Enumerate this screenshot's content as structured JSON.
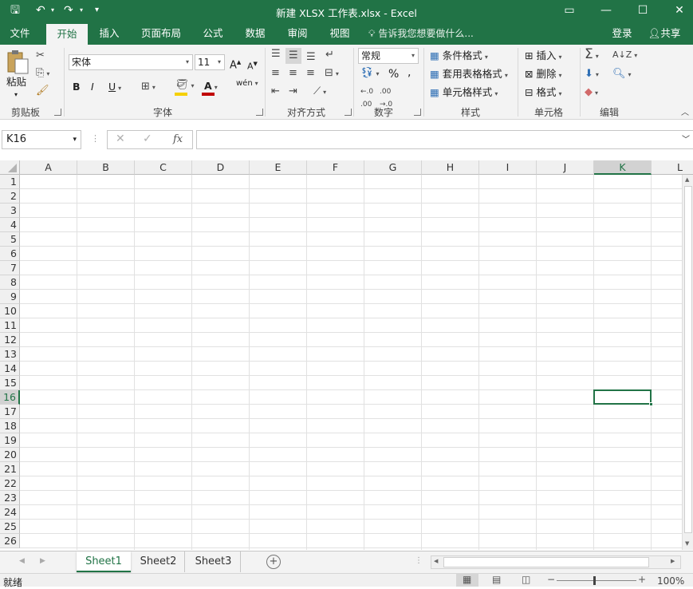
{
  "title": "新建 XLSX 工作表.xlsx - Excel",
  "quick_access": {
    "save": "🖫",
    "undo": "↶",
    "redo": "↷",
    "customize": "▾"
  },
  "window_controls": {
    "ribbon_options": "▭",
    "minimize": "—",
    "maximize": "☐",
    "close": "✕"
  },
  "tabs": [
    "文件",
    "开始",
    "插入",
    "页面布局",
    "公式",
    "数据",
    "审阅",
    "视图"
  ],
  "tell_me": "告诉我您想要做什么...",
  "login": "登录",
  "share": "共享",
  "ribbon": {
    "clipboard": {
      "label": "剪贴板",
      "paste": "粘贴"
    },
    "font": {
      "label": "字体",
      "name": "宋体",
      "size": "11",
      "bold": "B",
      "italic": "I",
      "underline": "U",
      "grow": "A",
      "shrink": "A",
      "font_color": "A",
      "phonetic": "wén"
    },
    "alignment": {
      "label": "对齐方式"
    },
    "number": {
      "label": "数字",
      "format": "常规",
      "percent": "%",
      "comma": ","
    },
    "styles": {
      "label": "样式",
      "conditional": "条件格式",
      "table": "套用表格格式",
      "cell_styles": "单元格样式"
    },
    "cells": {
      "label": "单元格",
      "insert": "插入",
      "delete": "删除",
      "format": "格式"
    },
    "editing": {
      "label": "编辑"
    }
  },
  "name_box": "K16",
  "formula_value": "",
  "columns": [
    "A",
    "B",
    "C",
    "D",
    "E",
    "F",
    "G",
    "H",
    "I",
    "J",
    "K",
    "L"
  ],
  "rows": [
    "1",
    "2",
    "3",
    "4",
    "5",
    "6",
    "7",
    "8",
    "9",
    "10",
    "11",
    "12",
    "13",
    "14",
    "15",
    "16",
    "17",
    "18",
    "19",
    "20",
    "21",
    "22",
    "23",
    "24",
    "25",
    "26"
  ],
  "active_cell": {
    "column": "K",
    "row": "16"
  },
  "sheets": [
    "Sheet1",
    "Sheet2",
    "Sheet3"
  ],
  "active_sheet": "Sheet1",
  "status": "就绪",
  "zoom": "100%",
  "colors": {
    "brand": "#217346"
  }
}
